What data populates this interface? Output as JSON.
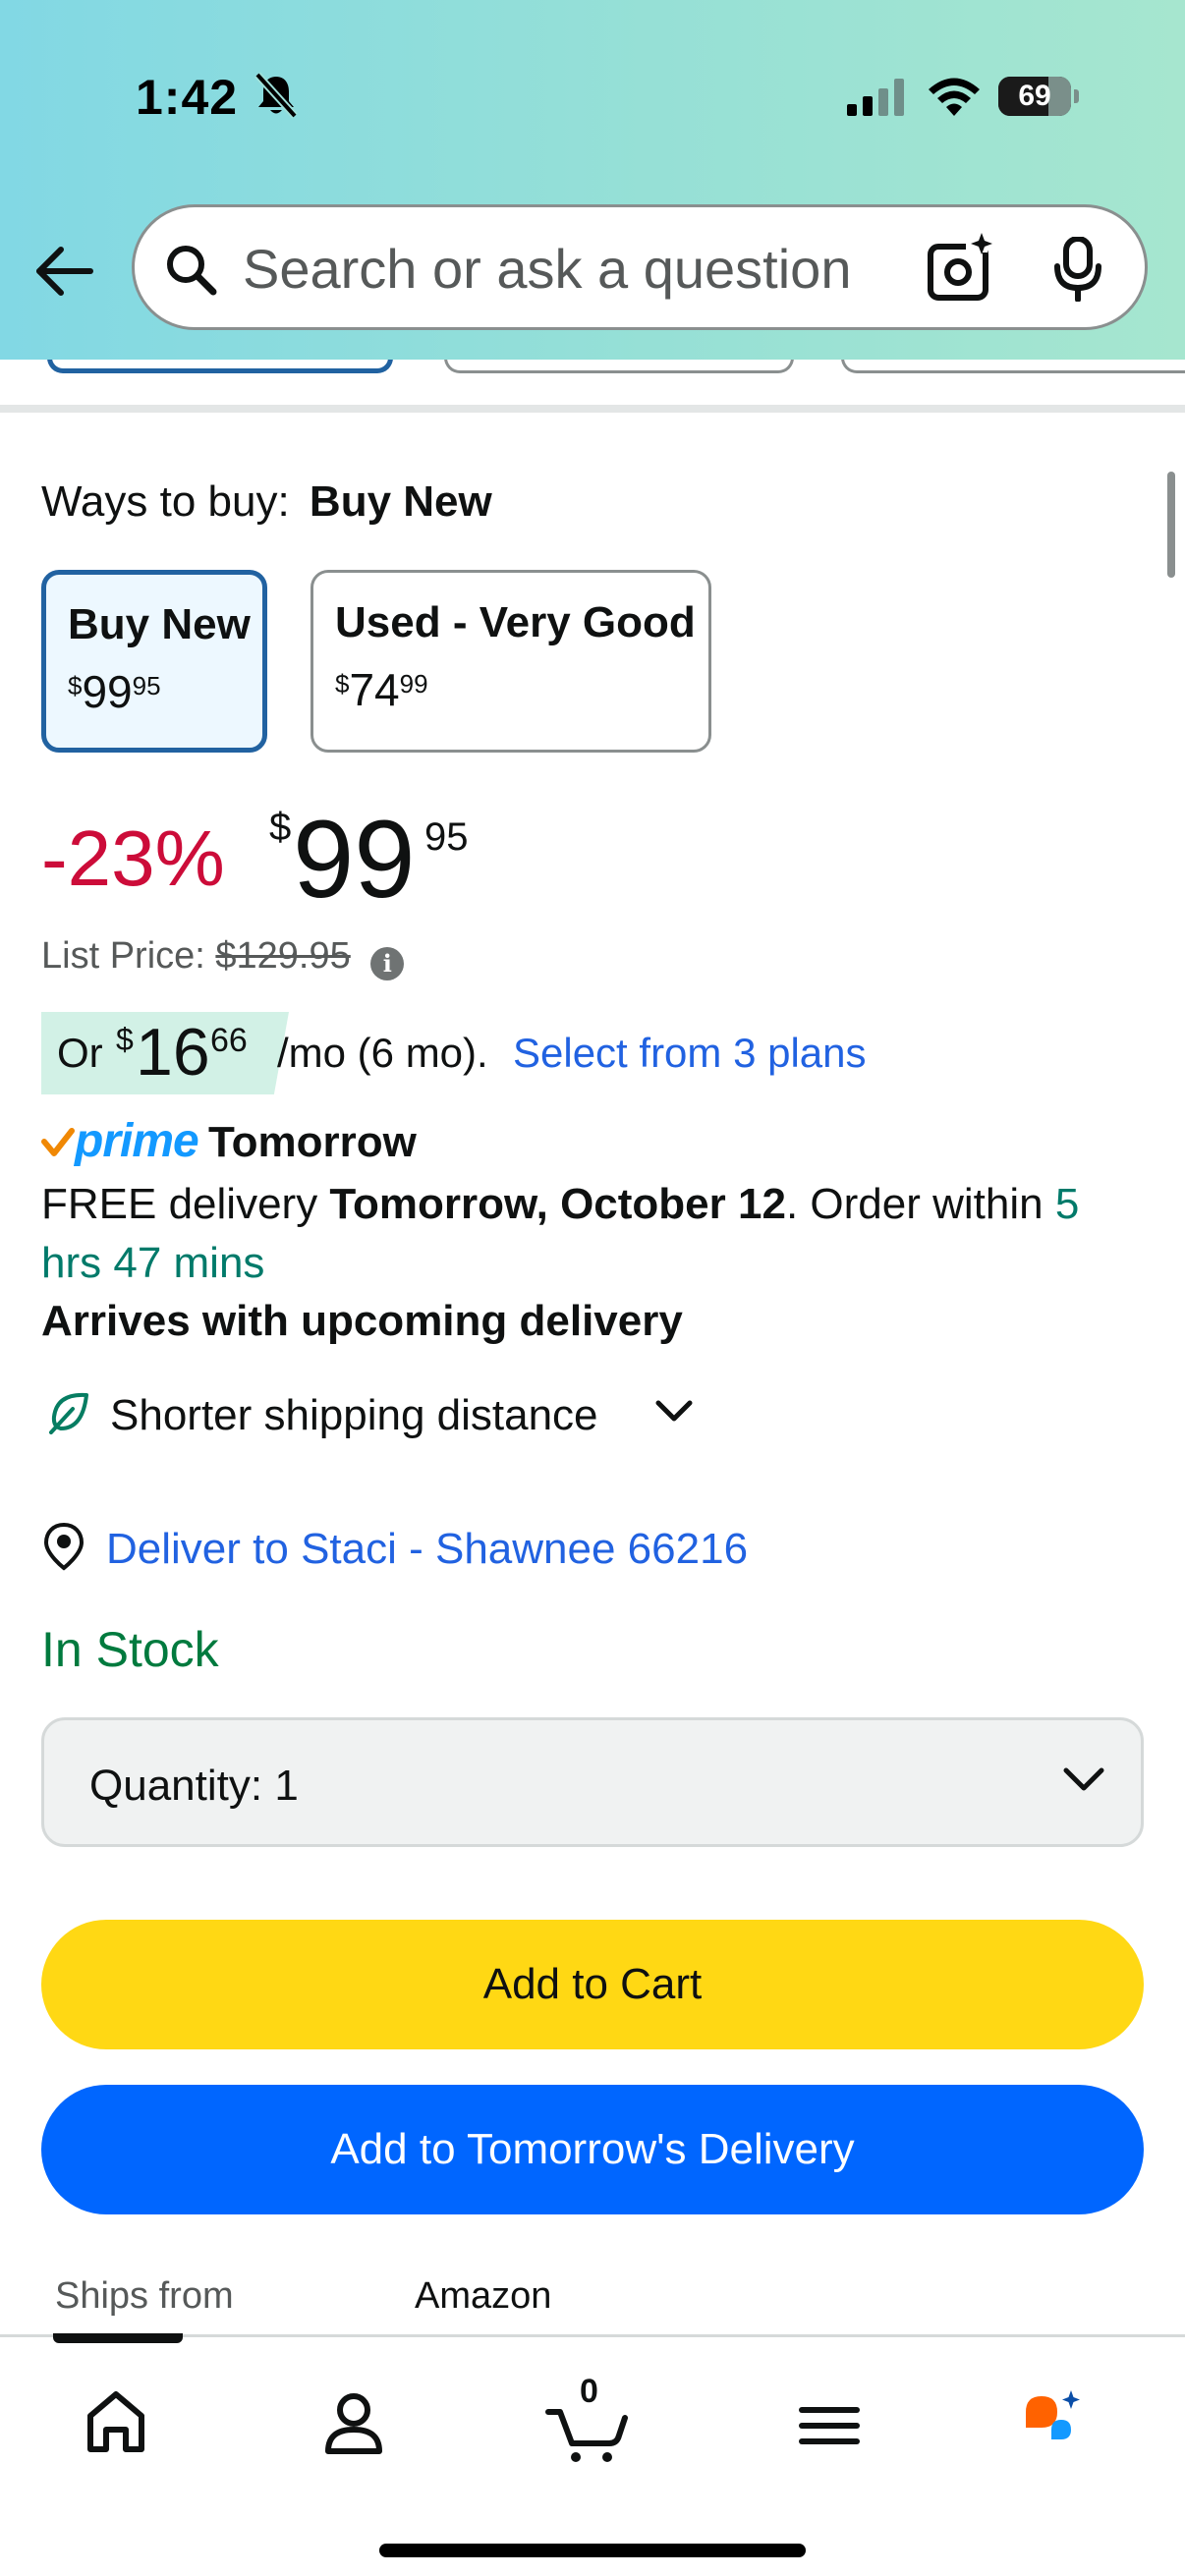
{
  "status_bar": {
    "time": "1:42",
    "battery": "69",
    "battery_level": 0.69
  },
  "search": {
    "placeholder": "Search or ask a question"
  },
  "ways_to_buy": {
    "label": "Ways to buy:",
    "selected": "Buy New",
    "options": [
      {
        "title": "Buy New",
        "symbol": "$",
        "whole": "99",
        "fraction": "95",
        "selected": true
      },
      {
        "title": "Used - Very Good",
        "symbol": "$",
        "whole": "74",
        "fraction": "99",
        "selected": false
      }
    ]
  },
  "price": {
    "discount": "-23%",
    "symbol": "$",
    "whole": "99",
    "fraction": "95",
    "list_price_label": "List Price:",
    "list_price_value": "$129.95"
  },
  "monthly": {
    "prefix": "Or",
    "symbol": "$",
    "whole": "16",
    "fraction": "66",
    "term": "/mo (6 mo).",
    "link": "Select from 3 plans"
  },
  "delivery": {
    "prime_logo": "prime",
    "prime_day": "Tomorrow",
    "free_prefix": "FREE delivery ",
    "free_date": "Tomorrow, October 12",
    "order_within": ". Order within ",
    "countdown": "5 hrs 47 mins",
    "arrives": "Arrives with upcoming delivery",
    "shorter_shipping": "Shorter shipping distance",
    "deliver_to": "Deliver to Staci - Shawnee 66216"
  },
  "stock": "In Stock",
  "quantity": {
    "label": "Quantity:",
    "value": "1"
  },
  "buttons": {
    "add_to_cart": "Add to Cart",
    "add_to_tomorrow": "Add to Tomorrow's Delivery"
  },
  "ships_from": {
    "label": "Ships from",
    "value": "Amazon"
  },
  "bottom_nav": {
    "cart_count": "0",
    "items": [
      "home-icon",
      "account-icon",
      "cart-icon",
      "menu-icon",
      "rufus-icon"
    ]
  },
  "colors": {
    "accent_yellow": "#ffd814",
    "accent_blue": "#0066ff",
    "discount_red": "#cc0c39",
    "link_blue": "#2162e1",
    "stock_green": "#007a3e",
    "prime_blue": "#1399ff"
  }
}
